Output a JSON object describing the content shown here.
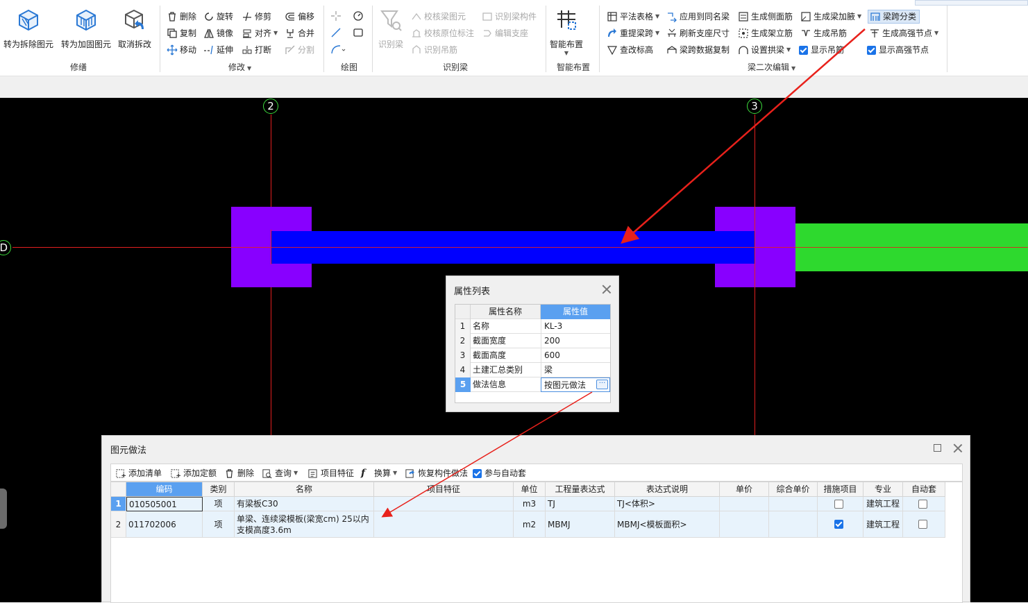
{
  "colors": {
    "canvas_bg": "#000000",
    "beam": "#0000ff",
    "column": "#8800ff",
    "beam_green": "#2ed92e",
    "axis": "#e31f1f",
    "accent": "#1a73e8",
    "arrow": "#e8211b"
  },
  "ribbon": {
    "xiushan": {
      "label": "修缮",
      "buttons": [
        "转为拆除图元",
        "转为加固图元",
        "取消拆改"
      ]
    },
    "modify": {
      "label": "修改",
      "items": [
        "删除",
        "旋转",
        "修剪",
        "偏移",
        "复制",
        "镜像",
        "对齐",
        "合并",
        "移动",
        "延伸",
        "打断",
        "分割"
      ]
    },
    "draw": {
      "label": "绘图"
    },
    "identify": {
      "label": "识别梁",
      "big": "识别梁",
      "items": [
        "校核梁图元",
        "识别梁构件",
        "校核原位标注",
        "编辑支座",
        "识别吊筋"
      ]
    },
    "smart": {
      "label": "智能布置",
      "big": "智能布置"
    },
    "edit2": {
      "label": "梁二次编辑",
      "items": [
        "平法表格",
        "应用到同名梁",
        "生成侧面筋",
        "生成梁加腋",
        "梁跨分类",
        "重提梁跨",
        "刷新支座尺寸",
        "生成架立筋",
        "生成吊筋",
        "生成高强节点",
        "查改标高",
        "梁跨数据复制",
        "设置拱梁",
        "显示吊筋",
        "显示高强节点"
      ]
    }
  },
  "axes": {
    "v1": "2",
    "v2": "3",
    "h1": "D"
  },
  "prop": {
    "title": "属性列表",
    "headers": [
      "属性名称",
      "属性值"
    ],
    "rows": [
      {
        "n": "1",
        "name": "名称",
        "value": "KL-3"
      },
      {
        "n": "2",
        "name": "截面宽度",
        "value": "200"
      },
      {
        "n": "3",
        "name": "截面高度",
        "value": "600"
      },
      {
        "n": "4",
        "name": "土建汇总类别",
        "value": "梁"
      },
      {
        "n": "5",
        "name": "做法信息",
        "value": "按图元做法"
      }
    ]
  },
  "method": {
    "title": "图元做法",
    "toolbar": [
      "添加清单",
      "添加定额",
      "删除",
      "查询",
      "项目特征",
      "换算",
      "恢复构件做法",
      "参与自动套"
    ],
    "headers": [
      "编码",
      "类别",
      "名称",
      "项目特征",
      "单位",
      "工程量表达式",
      "表达式说明",
      "单价",
      "综合单价",
      "措施项目",
      "专业",
      "自动套"
    ],
    "rows": [
      {
        "n": "1",
        "code": "010505001",
        "type": "项",
        "name": "有梁板C30",
        "feature": "",
        "unit": "m3",
        "expr": "TJ",
        "desc": "TJ<体积>",
        "price": "",
        "cprice": "",
        "measure": false,
        "major": "建筑工程",
        "auto": false
      },
      {
        "n": "2",
        "code": "011702006",
        "type": "项",
        "name": "单梁、连续梁模板(梁宽cm) 25以内支模高度3.6m",
        "feature": "",
        "unit": "m2",
        "expr": "MBMJ",
        "desc": "MBMJ<模板面积>",
        "price": "",
        "cprice": "",
        "measure": true,
        "major": "建筑工程",
        "auto": false
      }
    ]
  }
}
